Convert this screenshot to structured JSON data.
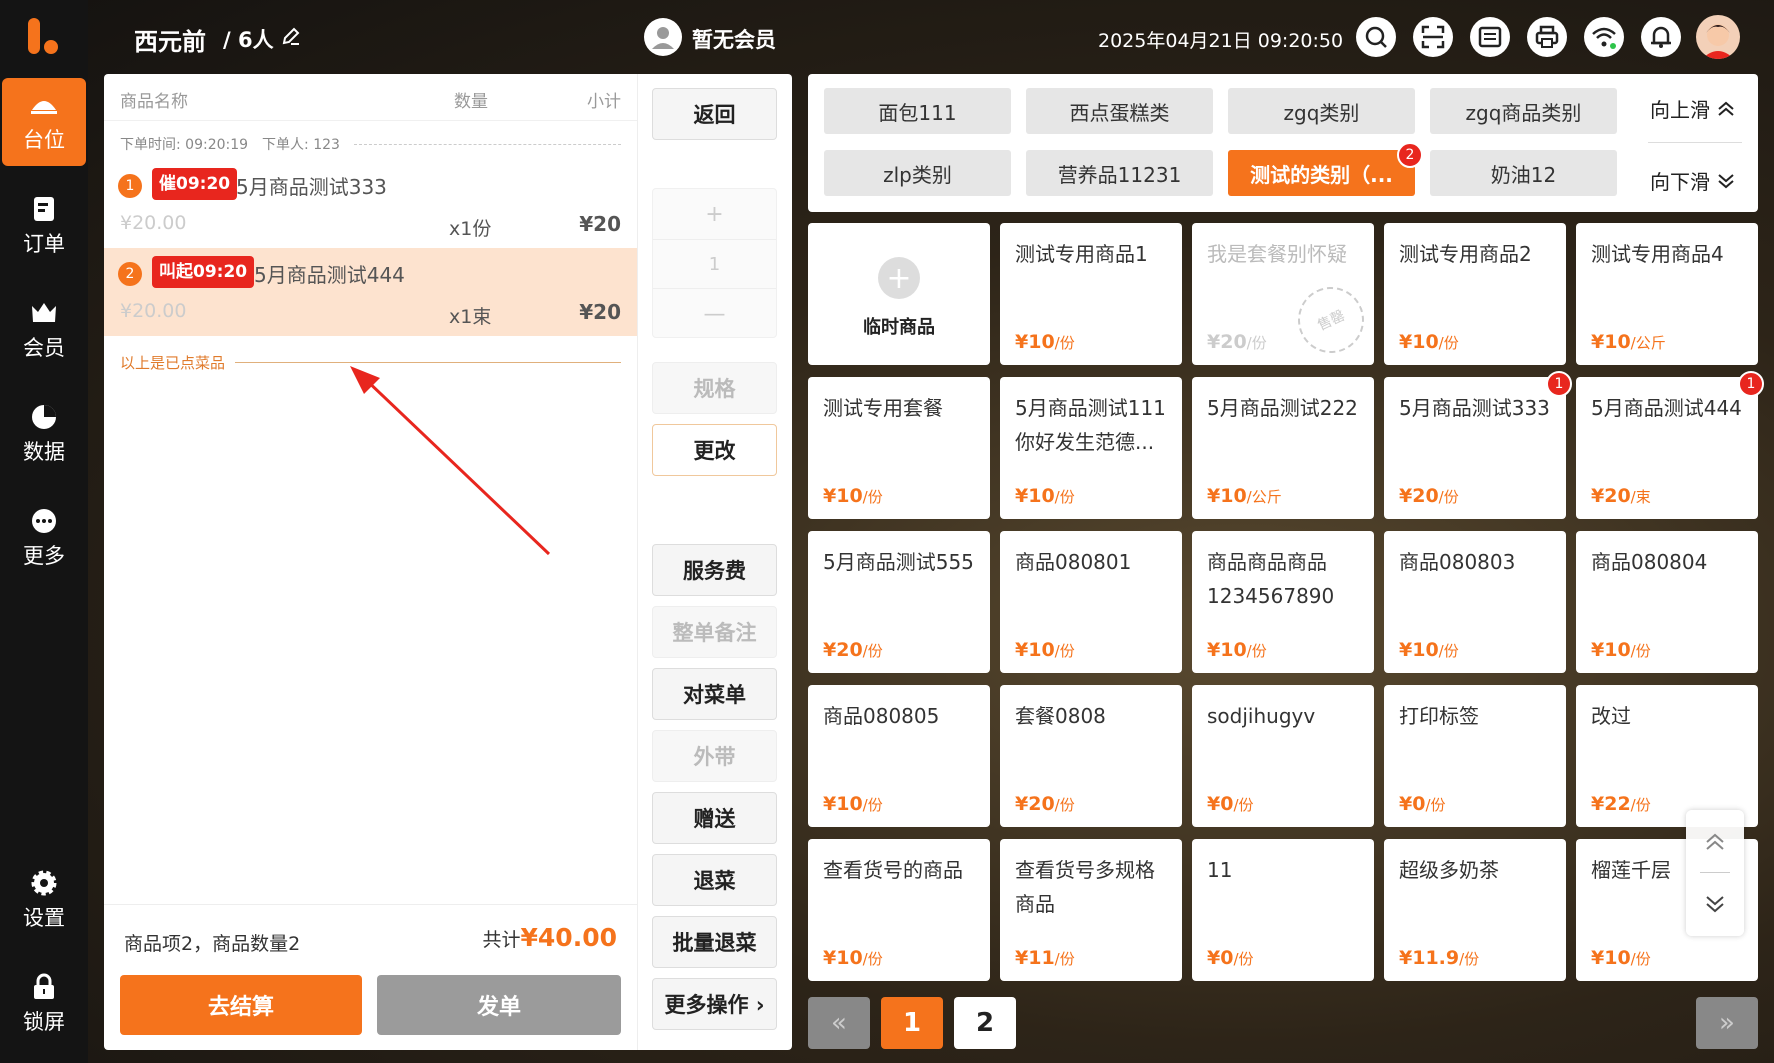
{
  "header": {
    "table_name": "西元前",
    "guests": "/ 6人",
    "member": "暂无会员",
    "datetime": "2025年04月21日 09:20:50"
  },
  "sidebar": {
    "items": [
      {
        "label": "台位"
      },
      {
        "label": "订单"
      },
      {
        "label": "会员"
      },
      {
        "label": "数据"
      },
      {
        "label": "更多"
      },
      {
        "label": "设置"
      },
      {
        "label": "锁屏"
      }
    ]
  },
  "order": {
    "col_name": "商品名称",
    "col_qty": "数量",
    "col_sub": "小计",
    "order_time": "下单时间: 09:20:19",
    "order_by": "下单人: 123",
    "items": [
      {
        "index": "1",
        "tag": "催09:20",
        "name": "5月商品测试333",
        "price": "¥20.00",
        "qty": "x1份",
        "subtotal": "¥20"
      },
      {
        "index": "2",
        "tag": "叫起09:20",
        "name": "5月商品测试444",
        "price": "¥20.00",
        "qty": "x1束",
        "subtotal": "¥20"
      }
    ],
    "ordered_label": "以上是已点菜品",
    "summary": "商品项2，商品数量2",
    "total_label": "共计",
    "total": "¥40.00",
    "checkout": "去结算",
    "send": "发单"
  },
  "actions": {
    "back": "返回",
    "plus": "+",
    "qty": "1",
    "minus": "—",
    "spec": "规格",
    "change": "更改",
    "service": "服务费",
    "note": "整单备注",
    "check": "对菜单",
    "takeout": "外带",
    "gift": "赠送",
    "return": "退菜",
    "batch_return": "批量退菜",
    "more": "更多操作 ›"
  },
  "categories": [
    {
      "label": "面包111"
    },
    {
      "label": "西点蛋糕类"
    },
    {
      "label": "zgq类别"
    },
    {
      "label": "zgq商品类别"
    },
    {
      "label": "zlp类别"
    },
    {
      "label": "营养品11231"
    },
    {
      "label": "测试的类别（...",
      "badge": "2"
    },
    {
      "label": "奶油12"
    }
  ],
  "scroll": {
    "up": "向上滑",
    "down": "向下滑"
  },
  "temp_product": {
    "plus": "+",
    "label": "临时商品"
  },
  "products": [
    {
      "name": "测试专用商品1",
      "price": "¥10",
      "unit": "/份"
    },
    {
      "name": "我是套餐别怀疑",
      "price": "¥20",
      "unit": "/份",
      "stamp": "售罄"
    },
    {
      "name": "测试专用商品2",
      "price": "¥10",
      "unit": "/份"
    },
    {
      "name": "测试专用商品4",
      "price": "¥10",
      "unit": "/公斤"
    },
    {
      "name": "测试专用套餐",
      "price": "¥10",
      "unit": "/份"
    },
    {
      "name": "5月商品测试111你好发生范德...",
      "price": "¥10",
      "unit": "/份"
    },
    {
      "name": "5月商品测试222",
      "price": "¥10",
      "unit": "/公斤"
    },
    {
      "name": "5月商品测试333",
      "price": "¥20",
      "unit": "/份",
      "badge": "1"
    },
    {
      "name": "5月商品测试444",
      "price": "¥20",
      "unit": "/束",
      "badge": "1"
    },
    {
      "name": "5月商品测试555",
      "price": "¥20",
      "unit": "/份"
    },
    {
      "name": "商品080801",
      "price": "¥10",
      "unit": "/份"
    },
    {
      "name": "商品商品商品1234567890",
      "price": "¥10",
      "unit": "/份"
    },
    {
      "name": "商品080803",
      "price": "¥10",
      "unit": "/份"
    },
    {
      "name": "商品080804",
      "price": "¥10",
      "unit": "/份"
    },
    {
      "name": "商品080805",
      "price": "¥10",
      "unit": "/份"
    },
    {
      "name": "套餐0808",
      "price": "¥20",
      "unit": "/份"
    },
    {
      "name": "sodjihugyv",
      "price": "¥0",
      "unit": "/份"
    },
    {
      "name": "打印标签",
      "price": "¥0",
      "unit": "/份"
    },
    {
      "name": "改过",
      "price": "¥22",
      "unit": "/份"
    },
    {
      "name": "查看货号的商品",
      "price": "¥10",
      "unit": "/份"
    },
    {
      "name": "查看货号多规格商品",
      "price": "¥11",
      "unit": "/份"
    },
    {
      "name": "11",
      "price": "¥0",
      "unit": "/份"
    },
    {
      "name": "超级多奶茶",
      "price": "¥11.9",
      "unit": "/份"
    },
    {
      "name": "榴莲千层",
      "price": "¥10",
      "unit": "/份"
    }
  ],
  "pager": {
    "prev": "«",
    "pages": [
      "1",
      "2"
    ],
    "next": "»"
  },
  "colors": {
    "accent": "#f5731c",
    "danger": "#e8261e"
  }
}
